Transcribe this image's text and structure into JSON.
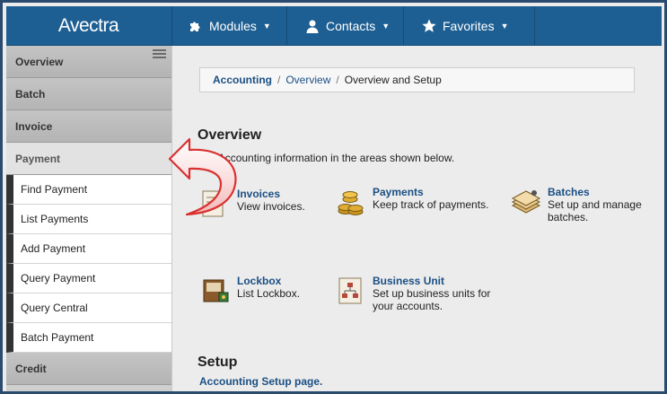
{
  "app": {
    "brand": "Avectra"
  },
  "topnav": [
    {
      "label": "Modules",
      "icon": "puzzle-icon"
    },
    {
      "label": "Contacts",
      "icon": "person-icon"
    },
    {
      "label": "Favorites",
      "icon": "star-icon"
    }
  ],
  "sidebar": {
    "sections": [
      "Overview",
      "Batch",
      "Invoice",
      "Payment",
      "Credit"
    ],
    "payment_items": [
      "Find Payment",
      "List Payments",
      "Add Payment",
      "Query Payment",
      "Query Central",
      "Batch Payment"
    ]
  },
  "breadcrumb": {
    "part1": "Accounting",
    "part2": "Overview",
    "part3": "Overview and Setup",
    "sep": "/"
  },
  "overview": {
    "heading": "Overview",
    "intro": "age Accounting information in the areas shown below.",
    "tiles": [
      {
        "title": "Invoices",
        "desc": "View invoices."
      },
      {
        "title": "Payments",
        "desc": "Keep track of payments."
      },
      {
        "title": "Batches",
        "desc1": "Set up and manage",
        "desc2": "batches."
      },
      {
        "title": "Lockbox",
        "desc": "List Lockbox."
      },
      {
        "title": "Business Unit",
        "desc1": "Set up business units for",
        "desc2": "your accounts."
      }
    ]
  },
  "setup": {
    "heading": "Setup",
    "link": "Accounting Setup page."
  },
  "colors": {
    "topbar": "#1e5f93",
    "link": "#1b4f84",
    "sidebar_active_bar": "#333333",
    "arrow": "#d93030"
  }
}
